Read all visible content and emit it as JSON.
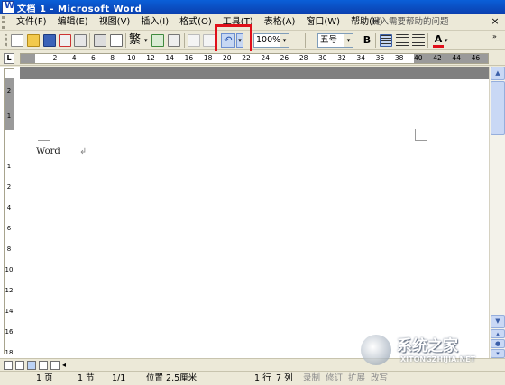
{
  "window": {
    "title": "文档 1 - Microsoft Word"
  },
  "menu": {
    "items": [
      "文件(F)",
      "编辑(E)",
      "视图(V)",
      "插入(I)",
      "格式(O)",
      "工具(T)",
      "表格(A)",
      "窗口(W)",
      "帮助(H)"
    ],
    "help_placeholder": "键入需要帮助的问题",
    "close_glyph": "×"
  },
  "toolbar": {
    "traditional_label": "繁",
    "zoom_value": "100%",
    "font_size_value": "五号",
    "bold_label": "B",
    "font_color_label": "A",
    "font_color": "#e0101a",
    "undo_glyph": "↶"
  },
  "ruler": {
    "tab_glyph": "L",
    "h_ticks": [
      "2",
      "4",
      "6",
      "8",
      "10",
      "12",
      "14",
      "16",
      "18",
      "20",
      "22",
      "24",
      "26",
      "28",
      "30",
      "32",
      "34",
      "36",
      "38",
      "40",
      "42",
      "44",
      "46"
    ],
    "v_ticks": [
      "2",
      "1",
      "1",
      "2",
      "4",
      "6",
      "8",
      "10",
      "12",
      "14",
      "16",
      "18"
    ]
  },
  "document": {
    "text": "Word",
    "para_mark": "↲"
  },
  "status": {
    "page": "1 页",
    "section": "1 节",
    "page_of": "1/1",
    "position": "位置 2.5厘米",
    "line": "1 行",
    "column": "7 列",
    "rec": "录制",
    "trk": "修订",
    "ext": "扩展",
    "ovr": "改写"
  },
  "watermark": {
    "brand": "系统之家",
    "url": "XITONGZHIJIA.NET"
  }
}
